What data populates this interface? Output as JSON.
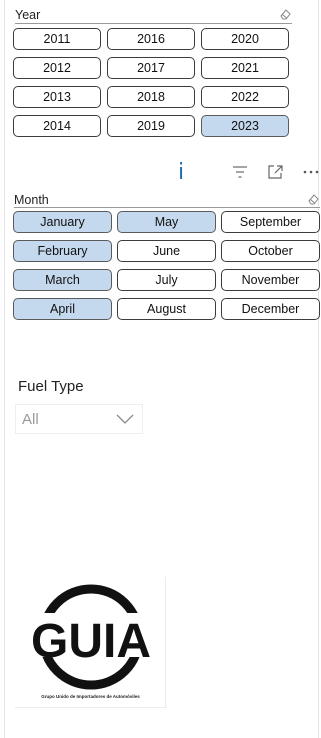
{
  "year_slicer": {
    "title": "Year",
    "items": [
      {
        "label": "2011",
        "selected": false
      },
      {
        "label": "2012",
        "selected": false
      },
      {
        "label": "2013",
        "selected": false
      },
      {
        "label": "2014",
        "selected": false
      },
      {
        "label": "2016",
        "selected": false
      },
      {
        "label": "2017",
        "selected": false
      },
      {
        "label": "2018",
        "selected": false
      },
      {
        "label": "2019",
        "selected": false
      },
      {
        "label": "2020",
        "selected": false
      },
      {
        "label": "2021",
        "selected": false
      },
      {
        "label": "2022",
        "selected": false
      },
      {
        "label": "2023",
        "selected": true
      }
    ]
  },
  "toolbar": {
    "info_glyph": "i",
    "icons": [
      "info-icon",
      "filter-icon",
      "focus-mode-icon",
      "more-options-icon"
    ]
  },
  "month_slicer": {
    "title": "Month",
    "items": [
      {
        "label": "January",
        "selected": true
      },
      {
        "label": "February",
        "selected": true
      },
      {
        "label": "March",
        "selected": true
      },
      {
        "label": "April",
        "selected": true
      },
      {
        "label": "May",
        "selected": true
      },
      {
        "label": "June",
        "selected": false
      },
      {
        "label": "July",
        "selected": false
      },
      {
        "label": "August",
        "selected": false
      },
      {
        "label": "September",
        "selected": false
      },
      {
        "label": "October",
        "selected": false
      },
      {
        "label": "November",
        "selected": false
      },
      {
        "label": "December",
        "selected": false
      }
    ]
  },
  "fuel_type": {
    "label": "Fuel Type",
    "value": "All"
  },
  "logo": {
    "text": "GUIA",
    "caption": "Grupo Unido de Importadores de Automóviles"
  },
  "colors": {
    "selected_fill": "#c5d9ee",
    "tile_border": "#3c3c3c",
    "accent": "#1f6fb2"
  }
}
